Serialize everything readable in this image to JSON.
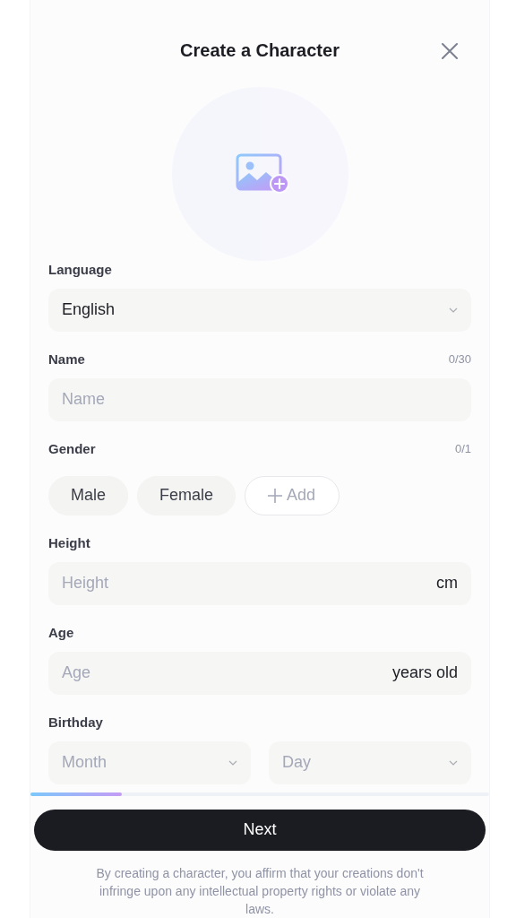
{
  "header": {
    "title": "Create a Character"
  },
  "photo_upload": {
    "kind": "picture-upload"
  },
  "sections": [
    {
      "kind": "select",
      "label": "Language",
      "value": "English"
    },
    {
      "kind": "text",
      "label": "Name",
      "counter": "0/30",
      "placeholder": "Name"
    },
    {
      "kind": "chips",
      "label": "Gender",
      "counter": "0/1",
      "chips": [
        {
          "label": "Male",
          "selected": false
        },
        {
          "label": "Female",
          "selected": false
        }
      ],
      "add_label": "Add"
    },
    {
      "kind": "unit",
      "label": "Height",
      "placeholder": "Height",
      "unit": "cm"
    },
    {
      "kind": "unit",
      "label": "Age",
      "placeholder": "Age",
      "unit": "years old"
    },
    {
      "kind": "date",
      "label": "Birthday",
      "selects": [
        {
          "placeholder": "Month"
        },
        {
          "placeholder": "Day"
        }
      ]
    }
  ],
  "progress": {
    "level": 0.2
  },
  "next_button": "Next",
  "disclaimer": "By creating a character, you affirm that your creations don't infringe upon any intellectual property rights or violate any laws."
}
